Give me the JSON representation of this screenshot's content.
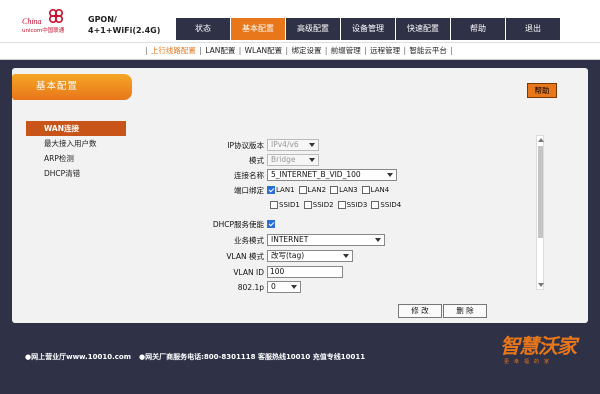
{
  "header": {
    "logo": {
      "line1": "China",
      "line2": "unicom中国联通"
    },
    "product": {
      "line1": "GPON/",
      "line2": "4+1+WiFi(2.4G)"
    },
    "nav": [
      "状态",
      "基本配置",
      "高级配置",
      "设备管理",
      "快速配置",
      "帮助",
      "退出"
    ],
    "active_nav": 1
  },
  "subnav": {
    "items": [
      "上行线路配置",
      "LAN配置",
      "WLAN配置",
      "绑定设置",
      "前缀管理",
      "远程管理",
      "智能云平台"
    ]
  },
  "section": {
    "title": "基本配置",
    "help_label": "帮助"
  },
  "sidebar": {
    "items": [
      "WAN连接",
      "最大接入用户数",
      "ARP检测",
      "DHCP清错"
    ]
  },
  "form": {
    "ip_version": {
      "label": "IP协议版本",
      "value": "IPv4/v6"
    },
    "mode": {
      "label": "模式",
      "value": "Bridge"
    },
    "connection_name": {
      "label": "连接名称",
      "value": "5_INTERNET_B_VID_100"
    },
    "port_binding": {
      "label": "端口绑定",
      "ports": [
        {
          "name": "LAN1",
          "checked": true
        },
        {
          "name": "LAN2",
          "checked": false
        },
        {
          "name": "LAN3",
          "checked": false
        },
        {
          "name": "LAN4",
          "checked": false
        },
        {
          "name": "SSID1",
          "checked": false
        },
        {
          "name": "SSID2",
          "checked": false
        },
        {
          "name": "SSID3",
          "checked": false
        },
        {
          "name": "SSID4",
          "checked": false
        }
      ]
    },
    "dhcp_enable": {
      "label": "DHCP服务使能",
      "checked": true
    },
    "service_mode": {
      "label": "业务模式",
      "value": "INTERNET"
    },
    "vlan_mode": {
      "label": "VLAN 模式",
      "value": "改写(tag)"
    },
    "vlan_id": {
      "label": "VLAN ID",
      "value": "100"
    },
    "dot1p": {
      "label": "802.1p",
      "value": "0"
    }
  },
  "buttons": {
    "modify": "修 改",
    "delete": "删 除"
  },
  "footer": {
    "hall": "●网上营业厅www.10010.com",
    "service": "●网关厂商服务电话:800-8301118 客服热线10010 充值专线10011"
  },
  "brand": {
    "name": "智慧沃家",
    "slogan": "更幸福的家"
  },
  "colors": {
    "accent": "#e8761b",
    "background": "#2f3147",
    "panel": "#f2f2f2"
  }
}
